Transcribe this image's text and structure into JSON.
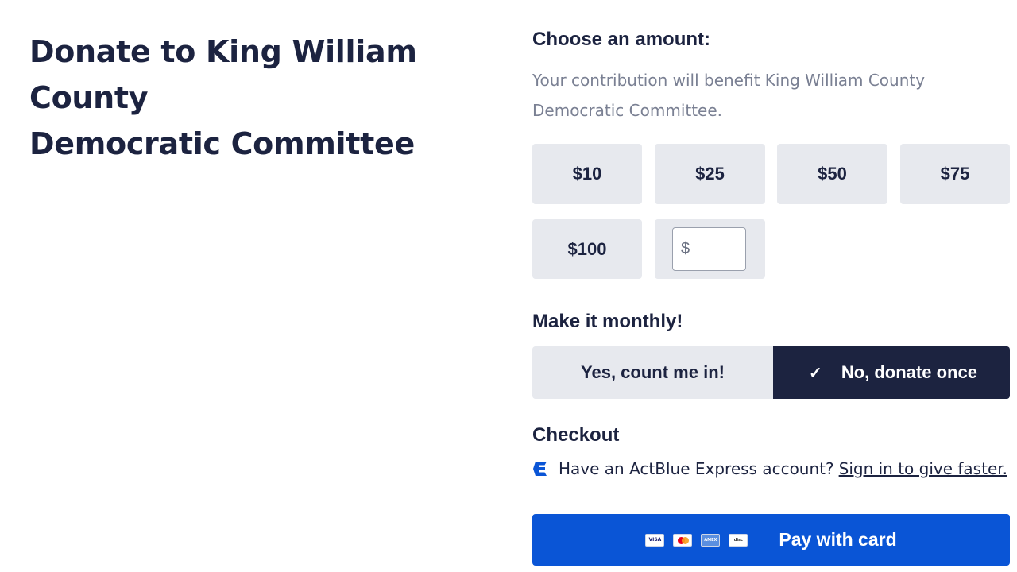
{
  "header": {
    "title_line1": "Donate to King William County",
    "title_line2": "Democratic Committee"
  },
  "amount_section": {
    "heading": "Choose an amount:",
    "description_line1": "Your contribution will benefit King William County",
    "description_line2": "Democratic Committee.",
    "amounts": [
      "$10",
      "$25",
      "$50",
      "$75",
      "$100"
    ],
    "custom": {
      "prefix": "$",
      "value": ""
    }
  },
  "recurring": {
    "heading": "Make it monthly!",
    "yes_label": "Yes, count me in!",
    "no_label": "No, donate once",
    "selected": "no"
  },
  "checkout": {
    "heading": "Checkout",
    "express_text": "Have an ActBlue Express account?",
    "signin_link": "Sign in to give faster.",
    "pay_label": "Pay with card",
    "card_icons": [
      "visa-card-icon",
      "mastercard-icon",
      "amex-card-icon",
      "discover-card-icon"
    ]
  },
  "colors": {
    "navy": "#1c2340",
    "option_bg": "#e7e9ee",
    "pay_blue": "#0a55d6",
    "muted_text": "#7a8093"
  }
}
